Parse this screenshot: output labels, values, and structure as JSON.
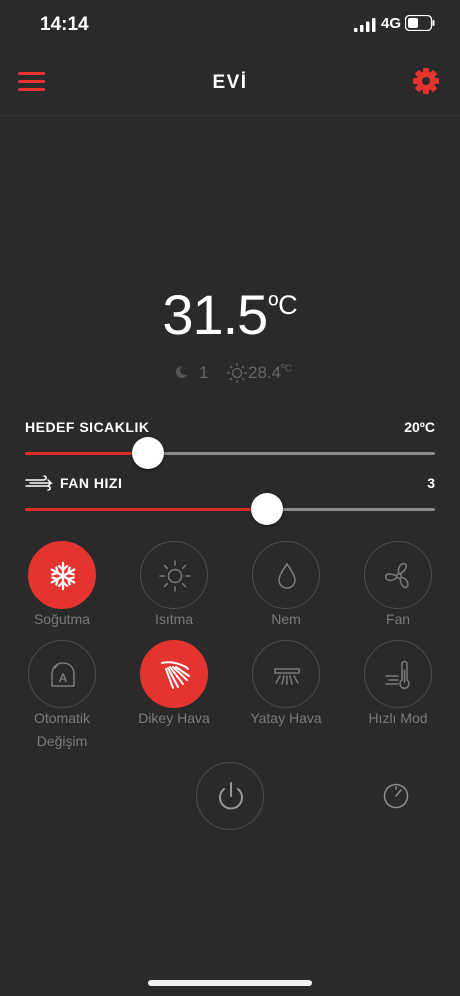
{
  "status_bar": {
    "time": "14:14",
    "network": "4G"
  },
  "header": {
    "title": "EVİ"
  },
  "temperature": {
    "value": "31.5",
    "unit": "ºC"
  },
  "sub_info": {
    "count": "1",
    "outdoor_temp": "28.4",
    "outdoor_unit": "ºC"
  },
  "target_temp": {
    "label": "HEDEF SICAKLIK",
    "value_text": "20ºC",
    "level_fraction": 0.3
  },
  "fan_speed": {
    "label": "FAN HIZI",
    "value_text": "3",
    "level_fraction": 0.59
  },
  "modes": [
    {
      "id": "sogutma",
      "label": "Soğutma",
      "icon": "snowflake-icon",
      "active": true
    },
    {
      "id": "isitma",
      "label": "Isıtma",
      "icon": "sun-icon",
      "active": false
    },
    {
      "id": "nem",
      "label": "Nem",
      "icon": "droplet-icon",
      "active": false
    },
    {
      "id": "fan",
      "label": "Fan",
      "icon": "fan-icon",
      "active": false
    },
    {
      "id": "otomatik",
      "label": "Otomatik Değişim",
      "icon": "auto-icon",
      "active": false
    },
    {
      "id": "dikey-hava",
      "label": "Dikey Hava",
      "icon": "vertical-swing-icon",
      "active": true
    },
    {
      "id": "yatay-hava",
      "label": "Yatay Hava",
      "icon": "horizontal-swing-icon",
      "active": false
    },
    {
      "id": "hizli-mod",
      "label": "Hızlı Mod",
      "icon": "turbo-icon",
      "active": false
    }
  ],
  "colors": {
    "accent": "#e53430",
    "background": "#2a2a2a",
    "inactive": "#7a7a7a"
  }
}
